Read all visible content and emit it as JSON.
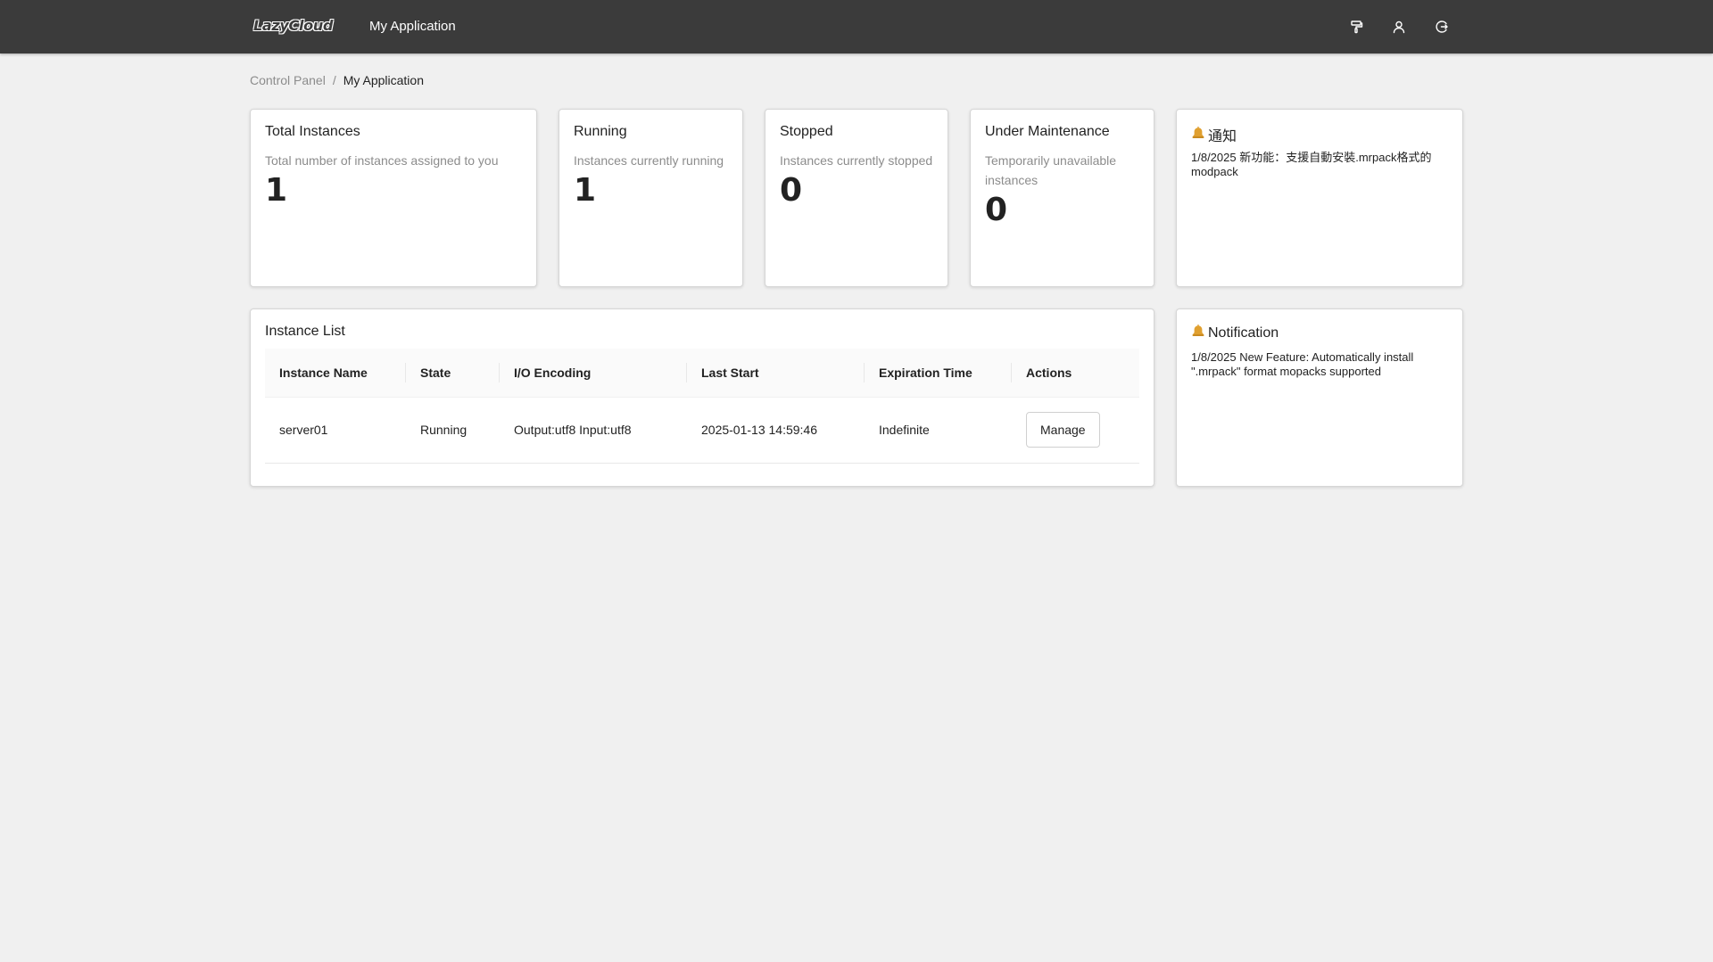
{
  "header": {
    "logo": "LazyCloud",
    "app_title": "My Application",
    "icons": [
      "theme-icon",
      "user-icon",
      "logout-icon"
    ]
  },
  "breadcrumb": {
    "root": "Control Panel",
    "separator": "/",
    "current": "My Application"
  },
  "stats": [
    {
      "title": "Total Instances",
      "desc": "Total number of instances assigned to you",
      "value": "1"
    },
    {
      "title": "Running",
      "desc": "Instances currently running",
      "value": "1"
    },
    {
      "title": "Stopped",
      "desc": "Instances currently stopped",
      "value": "0"
    },
    {
      "title": "Under Maintenance",
      "desc": "Temporarily unavailable instances",
      "value": "0"
    }
  ],
  "notice_zh": {
    "icon": "bell-icon",
    "title": "通知",
    "body": "1/8/2025 新功能：支援自動安裝.mrpack格式的modpack"
  },
  "notice_en": {
    "icon": "bell-icon",
    "title": "Notification",
    "body": "1/8/2025 New Feature: Automatically install \".mrpack\" format mopacks supported"
  },
  "instance_list": {
    "title": "Instance List",
    "columns": [
      "Instance Name",
      "State",
      "I/O Encoding",
      "Last Start",
      "Expiration Time",
      "Actions"
    ],
    "rows": [
      {
        "name": "server01",
        "state": "Running",
        "encoding": "Output:utf8 Input:utf8",
        "last_start": "2025-01-13 14:59:46",
        "expiration": "Indefinite",
        "action": "Manage"
      }
    ]
  },
  "colors": {
    "topbar": "#3b3b3b",
    "background": "#f0f0f0",
    "card": "#ffffff",
    "bell": "#e0a030"
  }
}
